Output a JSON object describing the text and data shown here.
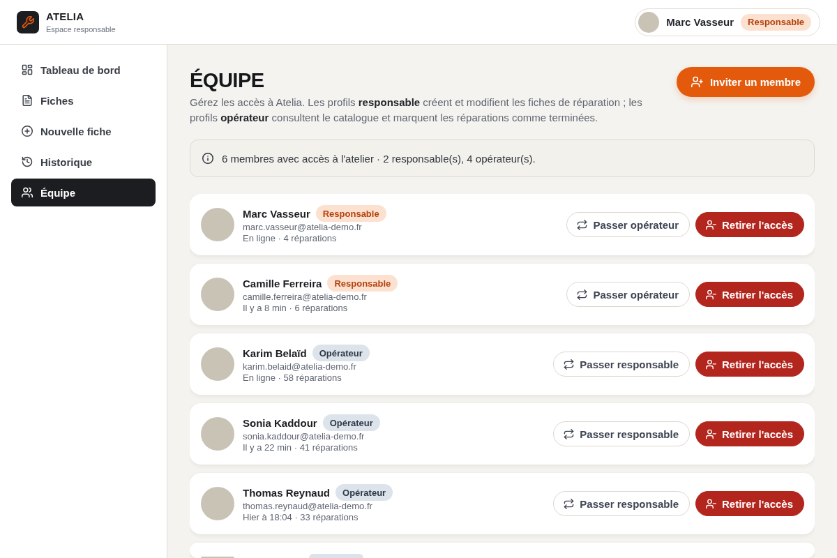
{
  "brand": {
    "name": "ATELIA",
    "subtitle": "Espace responsable"
  },
  "user": {
    "name": "Marc Vasseur",
    "role": "Responsable",
    "kind": "manager"
  },
  "sidebar": {
    "items": [
      {
        "label": "Tableau de bord",
        "selected": false
      },
      {
        "label": "Fiches",
        "selected": false
      },
      {
        "label": "Nouvelle fiche",
        "selected": false
      },
      {
        "label": "Historique",
        "selected": false
      },
      {
        "label": "Équipe",
        "selected": true
      }
    ]
  },
  "page": {
    "title": "ÉQUIPE",
    "description": "Gérez les accès à Atelia. Les profils **responsable** créent et modifient les fiches de réparation ; les profils **opérateur** consultent le catalogue et marquent les réparations comme terminées.",
    "invite_button": "Inviter un membre"
  },
  "notice": "6 membres avec accès à l'atelier · 2 responsable(s), 4 opérateur(s).",
  "members": [
    {
      "name": "Marc Vasseur",
      "role": "Responsable",
      "kind": "manager",
      "email": "marc.vasseur@atelia-demo.fr",
      "activity": "En ligne · 4 réparations",
      "switch_button": "Passer opérateur",
      "remove_button": "Retirer l'accès"
    },
    {
      "name": "Camille Ferreira",
      "role": "Responsable",
      "kind": "manager",
      "email": "camille.ferreira@atelia-demo.fr",
      "activity": "Il y a 8 min · 6 réparations",
      "switch_button": "Passer opérateur",
      "remove_button": "Retirer l'accès"
    },
    {
      "name": "Karim Belaïd",
      "role": "Opérateur",
      "kind": "operator",
      "email": "karim.belaid@atelia-demo.fr",
      "activity": "En ligne · 58 réparations",
      "switch_button": "Passer responsable",
      "remove_button": "Retirer l'accès"
    },
    {
      "name": "Sonia Kaddour",
      "role": "Opérateur",
      "kind": "operator",
      "email": "sonia.kaddour@atelia-demo.fr",
      "activity": "Il y a 22 min · 41 réparations",
      "switch_button": "Passer responsable",
      "remove_button": "Retirer l'accès"
    },
    {
      "name": "Thomas Reynaud",
      "role": "Opérateur",
      "kind": "operator",
      "email": "thomas.reynaud@atelia-demo.fr",
      "activity": "Hier à 18:04 · 33 réparations",
      "switch_button": "Passer responsable",
      "remove_button": "Retirer l'accès"
    },
    {
      "kind": "operator"
    }
  ]
}
